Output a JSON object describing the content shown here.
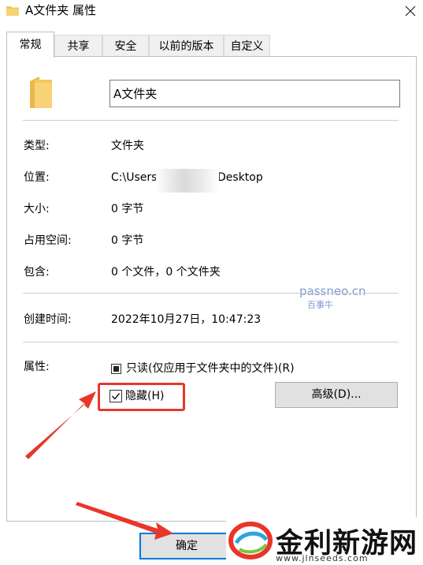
{
  "window": {
    "title": "A文件夹 属性",
    "close_icon": "close-icon"
  },
  "tabs": [
    {
      "label": "常规",
      "active": true
    },
    {
      "label": "共享"
    },
    {
      "label": "安全"
    },
    {
      "label": "以前的版本"
    },
    {
      "label": "自定义"
    }
  ],
  "general": {
    "folder_name": "A文件夹",
    "rows": [
      {
        "label": "类型:",
        "value": "文件夹"
      },
      {
        "label": "位置:",
        "value": "C:\\Users",
        "value_end": "Desktop"
      },
      {
        "label": "大小:",
        "value": "0 字节"
      },
      {
        "label": "占用空间:",
        "value": "0 字节"
      },
      {
        "label": "包含:",
        "value": "0 个文件，0 个文件夹"
      },
      {
        "label": "创建时间:",
        "value": "2022年10月27日，10:47:23"
      }
    ],
    "attributes_label": "属性:",
    "readonly_label": "只读(仅应用于文件夹中的文件)(R)",
    "hidden_label": "隐藏(H)",
    "hidden_checked": true,
    "advanced_button": "高级(D)..."
  },
  "footer": {
    "ok_button": "确定"
  },
  "watermark": {
    "line1": "passneo.cn",
    "line2": "百事牛"
  },
  "brand": {
    "name": "金利新游网",
    "url": "www.jlnseeds.com"
  },
  "colors": {
    "accent": "#0078d7",
    "highlight": "#e8362a",
    "folder": "#f4c85b"
  }
}
